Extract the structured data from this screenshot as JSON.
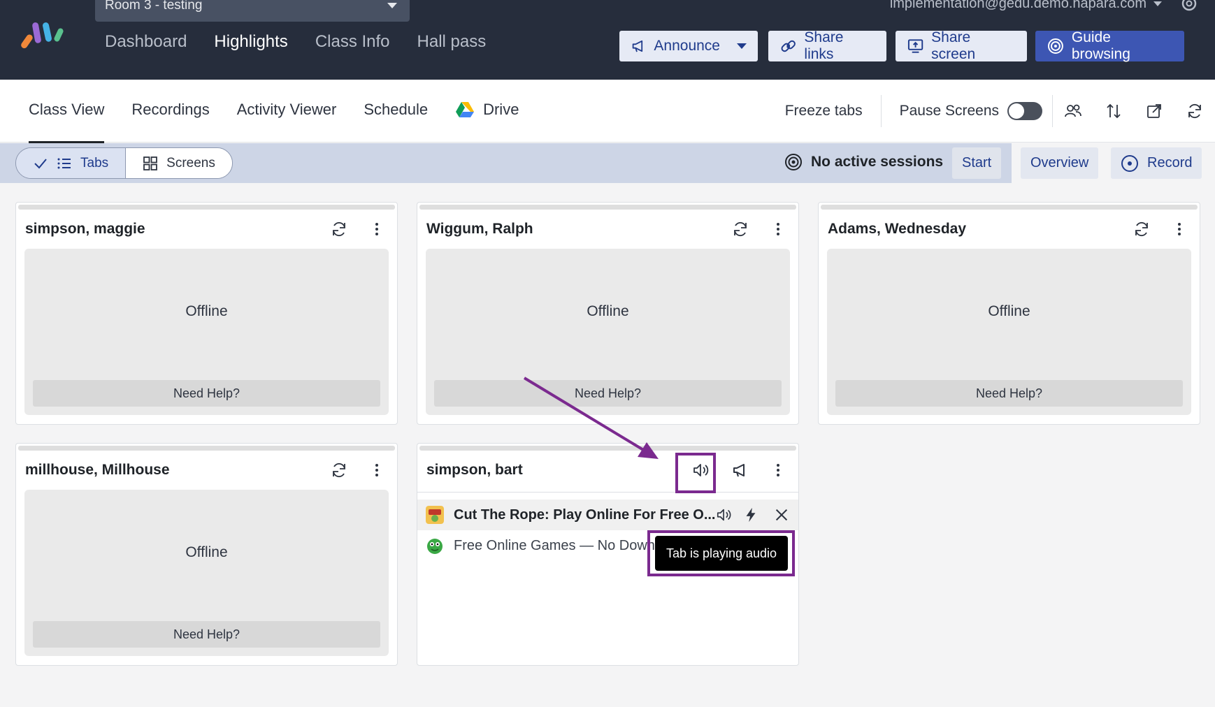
{
  "header": {
    "room_select": "Room 3 - testing",
    "account_email": "implementation@gedu.demo.hapara.com",
    "nav": [
      {
        "label": "Dashboard",
        "active": false
      },
      {
        "label": "Highlights",
        "active": true
      },
      {
        "label": "Class Info",
        "active": false
      },
      {
        "label": "Hall pass",
        "active": false
      }
    ],
    "actions": {
      "announce": "Announce",
      "share_links": "Share links",
      "share_screen": "Share screen",
      "guide_browsing": "Guide browsing"
    }
  },
  "subnav": {
    "tabs": [
      "Class View",
      "Recordings",
      "Activity Viewer",
      "Schedule",
      "Drive"
    ],
    "active_tab": "Class View",
    "freeze_tabs": "Freeze tabs",
    "pause_screens": "Pause Screens",
    "pause_screens_on": false,
    "tool_icons": [
      "people-icon",
      "sort-icon",
      "open-external-icon",
      "refresh-icon"
    ]
  },
  "filterbar": {
    "view_tabs": "Tabs",
    "view_screens": "Screens",
    "selected_view": "Tabs",
    "session_status": "No active sessions",
    "start": "Start",
    "overview": "Overview",
    "record": "Record"
  },
  "students": [
    {
      "name": "simpson, maggie",
      "status": "Offline",
      "help": "Need Help?"
    },
    {
      "name": "Wiggum, Ralph",
      "status": "Offline",
      "help": "Need Help?"
    },
    {
      "name": "Adams, Wednesday",
      "status": "Offline",
      "help": "Need Help?"
    },
    {
      "name": "millhouse, Millhouse",
      "status": "Offline",
      "help": "Need Help?"
    }
  ],
  "bart": {
    "name": "simpson, bart",
    "tabs": [
      {
        "title": "Cut The Rope: Play Online For Free O...",
        "playing_audio": true
      },
      {
        "title": "Free Online Games — No Downl",
        "playing_audio": false
      }
    ],
    "tooltip": "Tab is playing audio"
  },
  "colors": {
    "topbar": "#262d3c",
    "accent": "#3d56b3",
    "annotation": "#7b2a8f"
  }
}
